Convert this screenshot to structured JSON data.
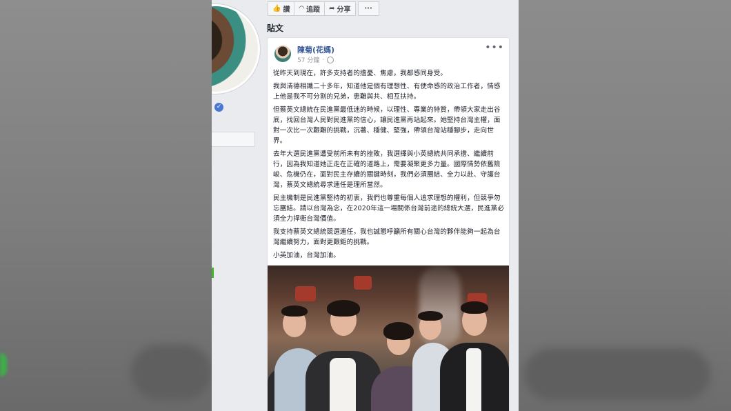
{
  "toolbar": {
    "like_label": "讚",
    "follow_label": "追蹤",
    "share_label": "分享",
    "more_label": "···"
  },
  "section_title": "貼文",
  "post": {
    "author": "陳菊(花媽)",
    "time": "57 分鐘",
    "more": "•••",
    "paragraphs": [
      "從昨天到現在，許多支持者的擔憂、焦慮，我都感同身受。",
      "我與清德相識二十多年，知道他是個有理想性、有使命感的政治工作者，情感上他是我不可分割的兄弟，患難與共、相互扶持。",
      "但蔡英文總統在民進黨最低迷的時候，以理性、專業的特質，帶領大家走出谷底，找回台灣人民對民進黨的信心，讓民進黨再站起來。她堅持台灣主權，面對一次比一次艱難的挑戰，沉著、穩健、堅強，帶領台灣站穩腳步，走向世界。",
      "去年大選民進黨遭受前所未有的挫敗，我選擇與小英總統共同承擔、繼續前行，因為我知道她正走在正確的道路上，需要凝聚更多力量。國際情勢依舊險峻、危機仍在，面對民主存續的關鍵時刻，我們必須團結、全力以赴、守護台灣，蔡英文總統尋求連任是理所當然。",
      "民主機制是民進黨堅持的初衷，我們也尊重每個人追求理想的權利，但競爭勿忘團結。請以台灣為念，在2020年這一場關係台灣前途的總統大選，民進黨必須全力捍衛台灣價值。",
      "我支持蔡英文總統競選連任，我也誠懇呼籲所有關心台灣的夥伴能夠一起為台灣繼續努力，面對更艱鉅的挑戰。",
      "小英加油，台灣加油。"
    ]
  },
  "icons": {
    "like": "thumbs-up-icon",
    "follow": "rss-icon",
    "share": "share-arrow-icon",
    "privacy": "globe-icon",
    "verified": "verified-check-icon"
  }
}
